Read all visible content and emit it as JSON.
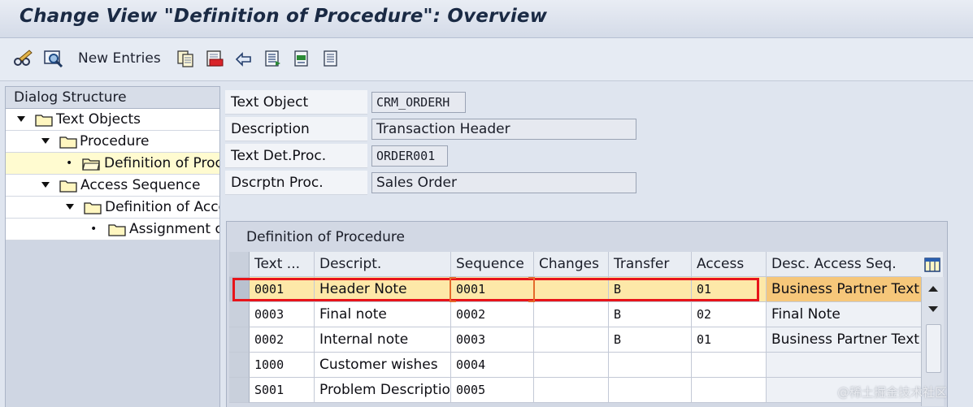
{
  "window": {
    "title": "Change View \"Definition of Procedure\": Overview"
  },
  "toolbar": {
    "items": [
      {
        "icon": "glasses-pencil-icon"
      },
      {
        "icon": "display-icon"
      },
      {
        "label": "New Entries"
      },
      {
        "icon": "copy-icon"
      },
      {
        "icon": "delete-icon"
      },
      {
        "icon": "undo-icon"
      },
      {
        "icon": "select-all-icon"
      },
      {
        "icon": "select-block-icon"
      },
      {
        "icon": "deselect-all-icon"
      }
    ]
  },
  "dialog_structure": {
    "title": "Dialog Structure",
    "items": [
      {
        "label": "Text Objects",
        "level": 0,
        "expanded": true
      },
      {
        "label": "Procedure",
        "level": 1,
        "expanded": true
      },
      {
        "label": "Definition of Proc",
        "level": 2,
        "selected": true
      },
      {
        "label": "Access Sequence",
        "level": 1,
        "expanded": true
      },
      {
        "label": "Definition of Acce",
        "level": 2,
        "expanded": true
      },
      {
        "label": "Assignment o",
        "level": 3
      }
    ]
  },
  "header_fields": {
    "text_object": {
      "label": "Text Object",
      "value": "CRM_ORDERH"
    },
    "description": {
      "label": "Description",
      "value": "Transaction Header"
    },
    "text_det_proc": {
      "label": "Text Det.Proc.",
      "value": "ORDER001"
    },
    "descr_proc": {
      "label": "Dscrptn Proc.",
      "value": "Sales Order"
    }
  },
  "table": {
    "title": "Definition of Procedure",
    "columns": [
      "Text ...",
      "Descript.",
      "Sequence",
      "Changes",
      "Transfer",
      "Access",
      "Desc. Access Seq."
    ],
    "rows": [
      {
        "text_id": "0001",
        "descript": "Header Note",
        "sequence": "0001",
        "changes": "",
        "transfer": "B",
        "access": "01",
        "desc_access": "Business Partner Text",
        "selected": true
      },
      {
        "text_id": "0003",
        "descript": "Final note",
        "sequence": "0002",
        "changes": "",
        "transfer": "B",
        "access": "02",
        "desc_access": "Final Note"
      },
      {
        "text_id": "0002",
        "descript": "Internal note",
        "sequence": "0003",
        "changes": "",
        "transfer": "B",
        "access": "01",
        "desc_access": "Business Partner Text"
      },
      {
        "text_id": "1000",
        "descript": "Customer wishes",
        "sequence": "0004",
        "changes": "",
        "transfer": "",
        "access": "",
        "desc_access": ""
      },
      {
        "text_id": "S001",
        "descript": "Problem Description",
        "sequence": "0005",
        "changes": "",
        "transfer": "",
        "access": "",
        "desc_access": ""
      }
    ]
  },
  "watermark": "@稀土掘金技术社区",
  "colors": {
    "highlight_border": "#e8141a",
    "selected_row": "#fde8a8",
    "selected_desc": "#f6c77a",
    "background": "#dfe5ef"
  }
}
